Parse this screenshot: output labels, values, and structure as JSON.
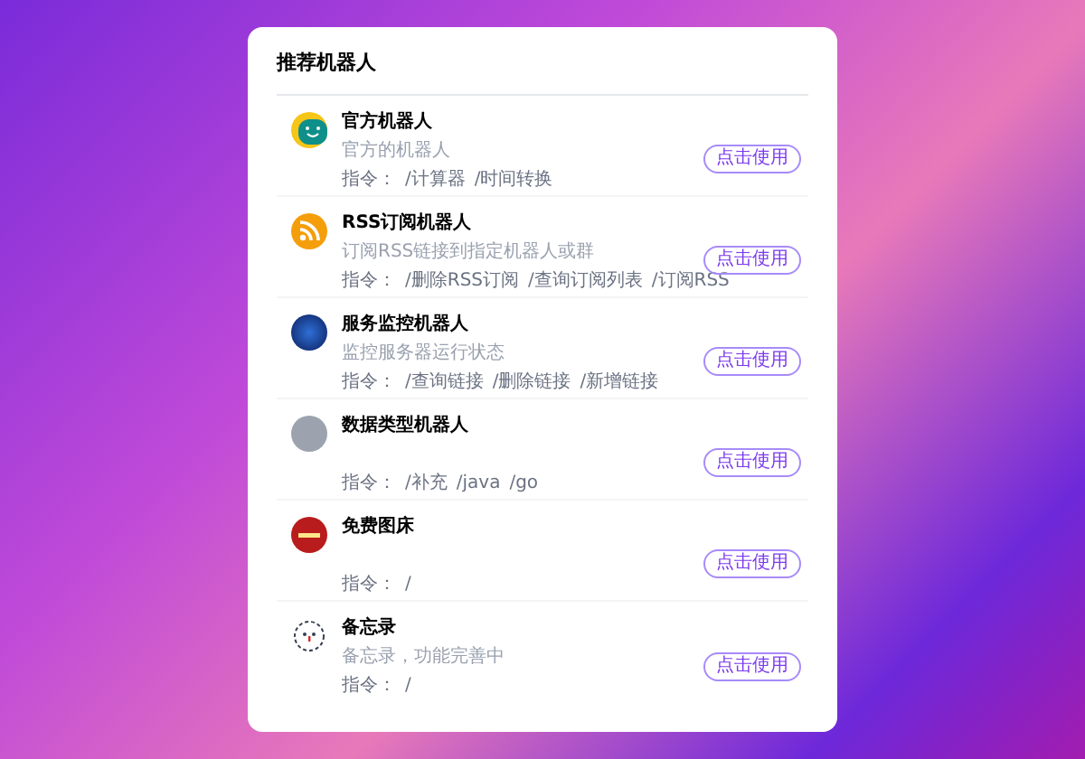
{
  "title": "推荐机器人",
  "bots": [
    {
      "name": "官方机器人",
      "description": "官方的机器人",
      "kind": "smiley",
      "command_label": "指令：",
      "commands": [
        "/计算器",
        "/时间转换"
      ],
      "button": "点击使用"
    },
    {
      "name": "RSS订阅机器人",
      "description": "订阅RSS链接到指定机器人或群",
      "kind": "rss",
      "command_label": "指令：",
      "commands": [
        "/删除RSS订阅",
        "/查询订阅列表",
        "/订阅RSS"
      ],
      "button": "点击使用"
    },
    {
      "name": "服务监控机器人",
      "description": "监控服务器运行状态",
      "kind": "photo",
      "command_label": "指令：",
      "commands": [
        "/查询链接",
        "/删除链接",
        "/新增链接"
      ],
      "button": "点击使用"
    },
    {
      "name": "数据类型机器人",
      "kind": "sketch",
      "command_label": "指令：",
      "commands": [
        "/补充",
        "/java",
        "/go"
      ],
      "button": "点击使用"
    },
    {
      "name": "免费图床",
      "kind": "badge",
      "command_label": "指令：",
      "commands": [
        "/"
      ],
      "button": "点击使用"
    },
    {
      "name": "备忘录",
      "description": "备忘录，功能完善中",
      "kind": "doodle",
      "command_label": "指令：",
      "commands": [
        "/"
      ],
      "button": "点击使用"
    }
  ]
}
